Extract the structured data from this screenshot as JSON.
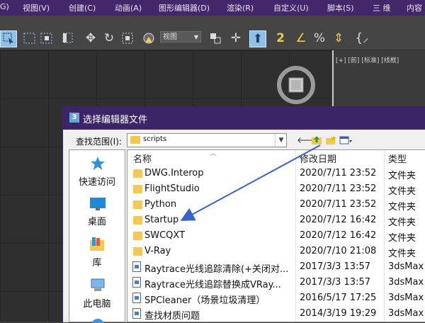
{
  "menubar": {
    "items": [
      "G)",
      "视图(V)",
      "创建(C)",
      "动画(A)",
      "图形编辑器(D)",
      "渲染(R)",
      "自定义(U)",
      "脚本(S)",
      "三 维",
      "内容"
    ]
  },
  "toolbar": {
    "view_select": "视图",
    "icons": [
      "select-icon",
      "region-select-icon",
      "window-crossing-icon",
      "move-icon",
      "rotate-icon",
      "scale-icon",
      "place-icon",
      "mirror-axis-icon",
      "pivot-icon",
      "snap-2-5-icon",
      "angle-snap-icon",
      "percent-snap-icon",
      "spinner-snap-icon",
      "named-selection-icon"
    ],
    "snap_label": "2",
    "percent_label": "%"
  },
  "viewport": {
    "label": "[+] [前] [标准] [线框]"
  },
  "dialog": {
    "title_icon": "3",
    "title": "选择编辑器文件",
    "lookin_label": "查找范围(I):",
    "lookin_value": "scripts",
    "sidebar": [
      {
        "icon": "quick-access-icon",
        "label": "快速访问"
      },
      {
        "icon": "desktop-icon",
        "label": "桌面"
      },
      {
        "icon": "library-icon",
        "label": "库"
      },
      {
        "icon": "this-pc-icon",
        "label": "此电脑"
      }
    ],
    "columns": {
      "name": "名称",
      "date": "修改日期",
      "type": "类型"
    },
    "files": [
      {
        "kind": "folder",
        "name": "DWG.Interop",
        "date": "2020/7/11 23:52",
        "type": "文件夹"
      },
      {
        "kind": "folder",
        "name": "FlightStudio",
        "date": "2020/7/11 23:52",
        "type": "文件夹"
      },
      {
        "kind": "folder",
        "name": "Python",
        "date": "2020/7/11 23:52",
        "type": "文件夹"
      },
      {
        "kind": "folder",
        "name": "Startup",
        "date": "2020/7/12 16:42",
        "type": "文件夹"
      },
      {
        "kind": "folder",
        "name": "SWCQXT",
        "date": "2020/7/12 16:42",
        "type": "文件夹"
      },
      {
        "kind": "folder",
        "name": "V-Ray",
        "date": "2020/7/10 21:08",
        "type": "文件夹"
      },
      {
        "kind": "file",
        "name": "Raytrace光线追踪清除(+关闭对...",
        "date": "2017/3/3 13:57",
        "type": "3dsMax"
      },
      {
        "kind": "file",
        "name": "Raytrace光线追踪替换成VRay...",
        "date": "2017/3/3 13:57",
        "type": "3dsMax"
      },
      {
        "kind": "file",
        "name": "SPCleaner（场景垃圾清理）",
        "date": "2016/5/17 17:25",
        "type": "3dsMax"
      },
      {
        "kind": "file",
        "name": "查找材质问题",
        "date": "2014/3/19 19:29",
        "type": "3dsMax"
      }
    ]
  },
  "colors": {
    "menubar": "#44276a",
    "dialog_title": "#3c2566",
    "annotation_arrow": "#3a63c8",
    "folder": "#f4c858"
  }
}
